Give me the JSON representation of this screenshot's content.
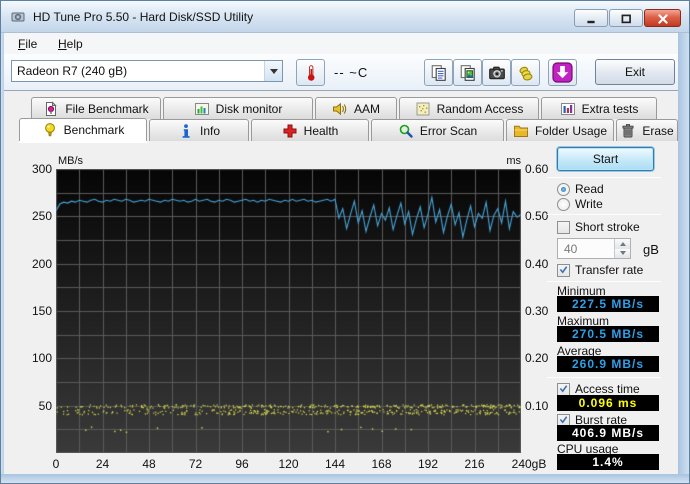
{
  "window": {
    "title": "HD Tune Pro 5.50 - Hard Disk/SSD Utility",
    "controls": [
      "minimize",
      "maximize",
      "close"
    ]
  },
  "menu": {
    "items": [
      "File",
      "Help"
    ]
  },
  "toolbar": {
    "drive_selected": "Radeon R7 (240 gB)",
    "temperature": "-- ~C",
    "buttons": [
      "copy-text-icon",
      "copy-image-icon",
      "camera-icon",
      "donate-icon",
      "save-results-icon"
    ],
    "exit_label": "Exit"
  },
  "tabs": {
    "top_row": [
      {
        "label": "File Benchmark",
        "icon": "file-benchmark-icon"
      },
      {
        "label": "Disk monitor",
        "icon": "disk-monitor-icon"
      },
      {
        "label": "AAM",
        "icon": "aam-speaker-icon"
      },
      {
        "label": "Random Access",
        "icon": "random-access-icon"
      },
      {
        "label": "Extra tests",
        "icon": "extra-tests-icon"
      }
    ],
    "bottom_row": [
      {
        "label": "Benchmark",
        "icon": "benchmark-bulb-icon",
        "active": true
      },
      {
        "label": "Info",
        "icon": "info-icon",
        "active": false
      },
      {
        "label": "Health",
        "icon": "health-icon",
        "active": false
      },
      {
        "label": "Error Scan",
        "icon": "error-scan-icon",
        "active": false
      },
      {
        "label": "Folder Usage",
        "icon": "folder-usage-icon",
        "active": false
      },
      {
        "label": "Erase",
        "icon": "erase-icon",
        "active": false
      }
    ]
  },
  "chart_data": {
    "type": "line+scatter",
    "x_axis": {
      "min": 0,
      "max": 240,
      "grid_step": 12,
      "ticks": [
        "0",
        "24",
        "48",
        "72",
        "96",
        "120",
        "144",
        "168",
        "192",
        "216",
        "240gB"
      ]
    },
    "y_left": {
      "label": "MB/s",
      "min": 0,
      "max": 300,
      "grid_step": 25,
      "ticks": [
        "300",
        "250",
        "200",
        "150",
        "100",
        "50"
      ]
    },
    "y_right": {
      "label": "ms",
      "min": 0,
      "max": 0.6,
      "ticks": [
        "0.60",
        "0.50",
        "0.40",
        "0.30",
        "0.20",
        "0.10"
      ]
    },
    "transfer_series": {
      "name": "Transfer rate",
      "color": "#46a5da",
      "x_start": 0,
      "x_step": 2,
      "values": [
        256,
        263,
        265,
        264,
        266,
        265,
        267,
        266,
        265,
        267,
        268,
        266,
        265,
        267,
        266,
        268,
        267,
        266,
        268,
        267,
        265,
        266,
        267,
        266,
        268,
        267,
        266,
        265,
        267,
        266,
        268,
        267,
        266,
        267,
        265,
        266,
        268,
        266,
        267,
        268,
        266,
        265,
        267,
        266,
        268,
        267,
        265,
        266,
        267,
        268,
        266,
        267,
        265,
        267,
        266,
        268,
        267,
        266,
        265,
        267,
        266,
        268,
        266,
        267,
        268,
        266,
        267,
        265,
        266,
        267,
        268,
        266,
        268,
        248,
        258,
        237,
        252,
        266,
        243,
        256,
        234,
        249,
        262,
        240,
        253,
        246,
        259,
        236,
        251,
        264,
        242,
        255,
        231,
        247,
        260,
        238,
        252,
        270,
        244,
        257,
        233,
        250,
        263,
        241,
        254,
        228,
        246,
        261,
        239,
        253,
        248,
        265,
        235,
        251,
        258,
        243,
        266,
        237,
        255,
        249,
        252
      ]
    },
    "access_scatter": {
      "name": "Access time",
      "color": "#dcdc50",
      "seed": 987654321,
      "bands": [
        {
          "y_min": 0.096,
          "y_max": 0.103,
          "count": 300
        },
        {
          "y_min": 0.082,
          "y_max": 0.093,
          "count": 330
        }
      ],
      "outlier_xs": [
        15,
        18,
        30,
        33,
        36,
        52,
        75,
        140,
        147,
        157,
        163,
        168,
        175,
        183
      ],
      "outlier_y_min": 0.044,
      "outlier_y_max": 0.056
    }
  },
  "side_panel": {
    "start_label": "Start",
    "mode": {
      "options": [
        "Read",
        "Write"
      ],
      "selected": "Read"
    },
    "short_stroke": {
      "label": "Short stroke",
      "checked": false,
      "value": "40",
      "unit": "gB"
    },
    "transfer_rate": {
      "label": "Transfer rate",
      "checked": true,
      "stats": [
        {
          "label": "Minimum",
          "value": "227.5 MB/s",
          "color": "#2f9fe8"
        },
        {
          "label": "Maximum",
          "value": "270.5 MB/s",
          "color": "#2f9fe8"
        },
        {
          "label": "Average",
          "value": "260.9 MB/s",
          "color": "#2f9fe8"
        }
      ]
    },
    "access_time": {
      "label": "Access time",
      "checked": true,
      "value": "0.096 ms",
      "color": "#ffff00"
    },
    "burst_rate": {
      "label": "Burst rate",
      "checked": true,
      "value": "406.9 MB/s",
      "color": "#ffffff"
    },
    "cpu_usage": {
      "label": "CPU usage",
      "value": "1.4%",
      "color": "#ffffff"
    }
  },
  "colors": {
    "plot_bg_top": "#060606",
    "plot_bg_bottom": "#3a3a3a",
    "grid": "#5a5a5a",
    "value_box_bg": "#000000",
    "accent_blue": "#2f9fe8"
  }
}
